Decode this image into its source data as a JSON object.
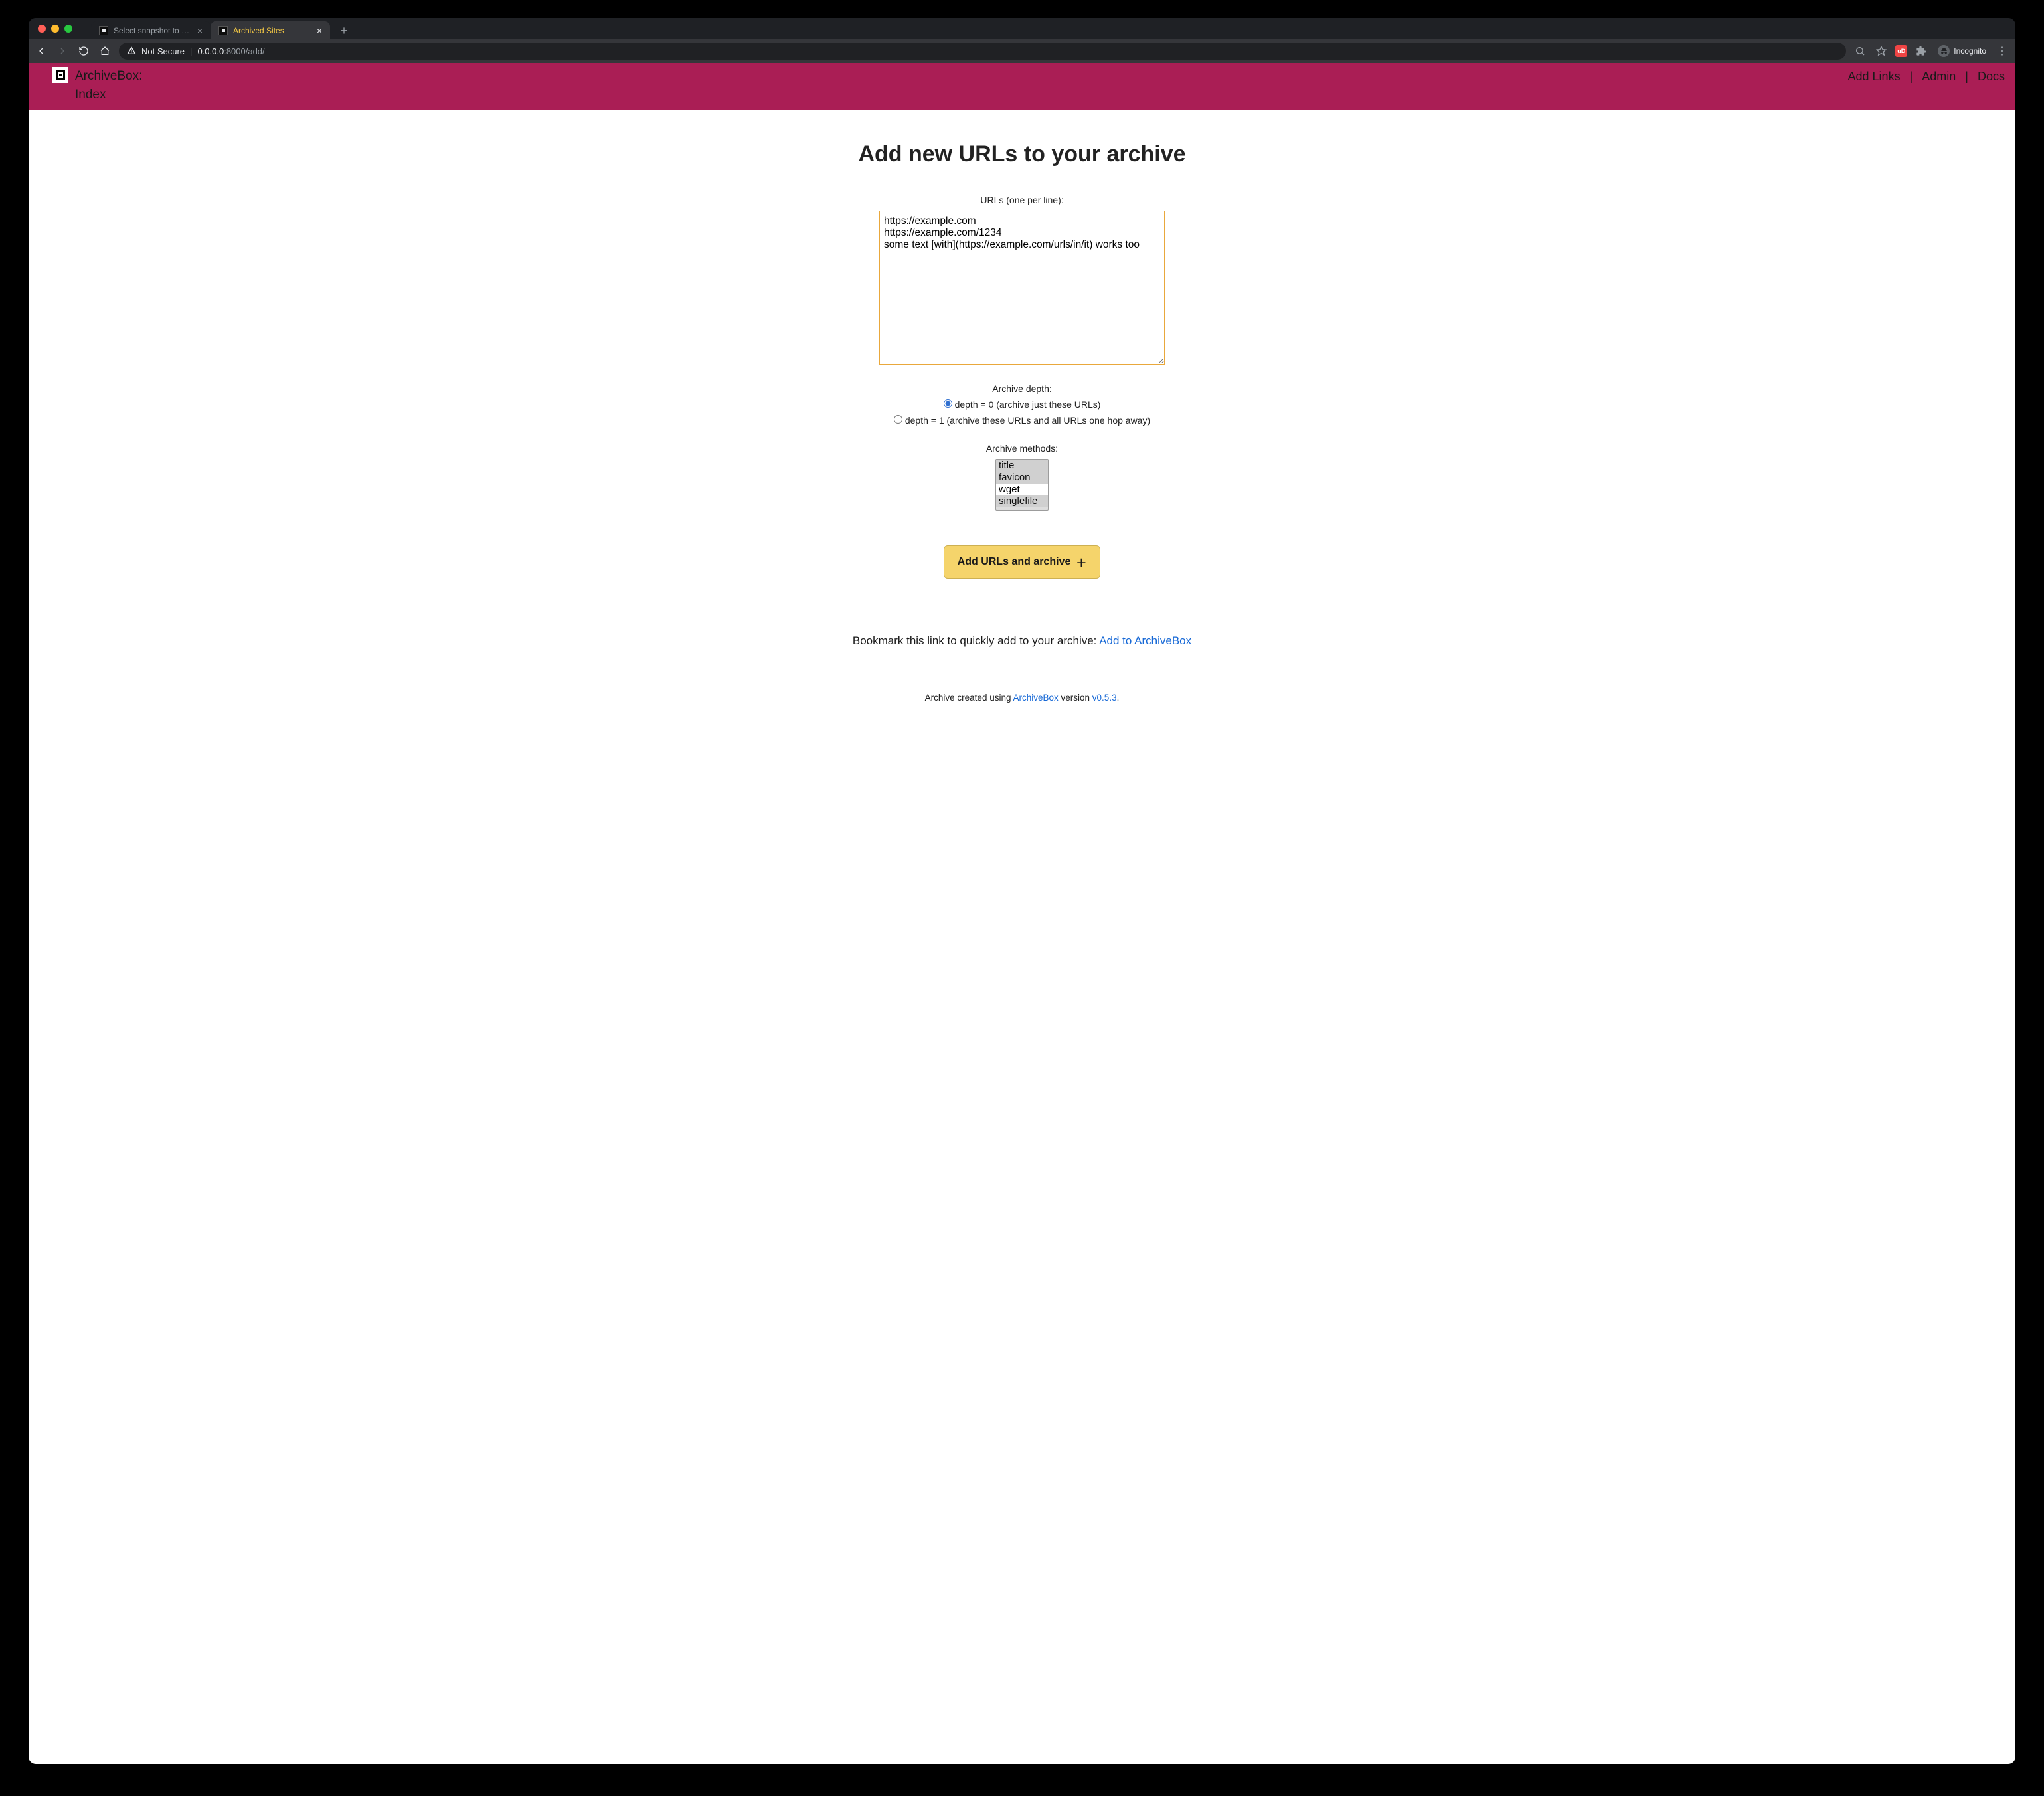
{
  "browser": {
    "tabs": [
      {
        "title": "Select snapshot to change | Inc…",
        "active": false
      },
      {
        "title": "Archived Sites",
        "active": true
      }
    ],
    "not_secure": "Not Secure",
    "url_host": "0.0.0.0",
    "url_rest": ":8000/add/",
    "ext_badge": "uD",
    "incognito_label": "Incognito"
  },
  "header": {
    "brand_l1": "ArchiveBox:",
    "brand_l2": "Index",
    "nav": {
      "add": "Add Links",
      "admin": "Admin",
      "docs": "Docs"
    }
  },
  "page": {
    "title": "Add new URLs to your archive",
    "urls_label": "URLs (one per line):",
    "urls_value": "https://example.com\nhttps://example.com/1234\nsome text [with](https://example.com/urls/in/it) works too",
    "depth_label": "Archive depth:",
    "depth_options": [
      {
        "label": "depth = 0 (archive just these URLs)",
        "checked": true
      },
      {
        "label": "depth = 1 (archive these URLs and all URLs one hop away)",
        "checked": false
      }
    ],
    "methods_label": "Archive methods:",
    "methods": [
      {
        "label": "title",
        "selected": true
      },
      {
        "label": "favicon",
        "selected": true
      },
      {
        "label": "wget",
        "selected": false
      },
      {
        "label": "singlefile",
        "selected": true
      }
    ],
    "submit_label": "Add URLs and archive",
    "bookmark_prefix": "Bookmark this link to quickly add to your archive: ",
    "bookmark_link": "Add to ArchiveBox"
  },
  "footer": {
    "prefix": "Archive created using ",
    "project": "ArchiveBox",
    "mid": " version ",
    "version": "v0.5.3",
    "suffix": "."
  }
}
